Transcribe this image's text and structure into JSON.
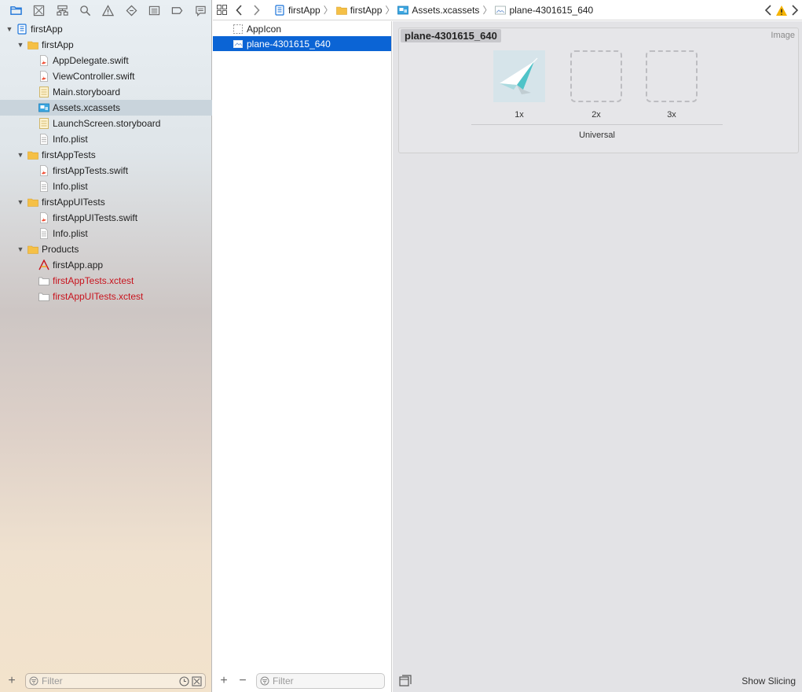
{
  "navigator": {
    "toolbar_icons": [
      "folder-icon",
      "source-control-icon",
      "symbol-icon",
      "find-icon",
      "issue-icon",
      "test-icon",
      "debug-icon",
      "breakpoint-icon",
      "report-icon"
    ],
    "tree": [
      {
        "label": "firstApp",
        "icon": "project-icon",
        "level": 0,
        "expanded": true
      },
      {
        "label": "firstApp",
        "icon": "folder-icon",
        "level": 1,
        "expanded": true
      },
      {
        "label": "AppDelegate.swift",
        "icon": "swift-file-icon",
        "level": 2
      },
      {
        "label": "ViewController.swift",
        "icon": "swift-file-icon",
        "level": 2
      },
      {
        "label": "Main.storyboard",
        "icon": "storyboard-icon",
        "level": 2
      },
      {
        "label": "Assets.xcassets",
        "icon": "asset-catalog-icon",
        "level": 2,
        "selected": true
      },
      {
        "label": "LaunchScreen.storyboard",
        "icon": "storyboard-icon",
        "level": 2
      },
      {
        "label": "Info.plist",
        "icon": "plist-icon",
        "level": 2
      },
      {
        "label": "firstAppTests",
        "icon": "folder-icon",
        "level": 1,
        "expanded": true
      },
      {
        "label": "firstAppTests.swift",
        "icon": "swift-file-icon",
        "level": 2
      },
      {
        "label": "Info.plist",
        "icon": "plist-icon",
        "level": 2
      },
      {
        "label": "firstAppUITests",
        "icon": "folder-icon",
        "level": 1,
        "expanded": true
      },
      {
        "label": "firstAppUITests.swift",
        "icon": "swift-file-icon",
        "level": 2
      },
      {
        "label": "Info.plist",
        "icon": "plist-icon",
        "level": 2
      },
      {
        "label": "Products",
        "icon": "folder-icon",
        "level": 1,
        "expanded": true
      },
      {
        "label": "firstApp.app",
        "icon": "app-icon",
        "level": 2
      },
      {
        "label": "firstAppTests.xctest",
        "icon": "xctest-icon",
        "level": 2,
        "missing": true
      },
      {
        "label": "firstAppUITests.xctest",
        "icon": "xctest-icon",
        "level": 2,
        "missing": true
      }
    ],
    "filter": {
      "placeholder": "Filter"
    }
  },
  "jumpbar": {
    "crumbs": [
      {
        "label": "firstApp",
        "icon": "project-icon"
      },
      {
        "label": "firstApp",
        "icon": "folder-icon"
      },
      {
        "label": "Assets.xcassets",
        "icon": "asset-catalog-icon"
      },
      {
        "label": "plane-4301615_640",
        "icon": "image-set-icon"
      }
    ]
  },
  "asset_list": {
    "items": [
      {
        "label": "AppIcon",
        "icon": "app-icon-set-icon"
      },
      {
        "label": "plane-4301615_640",
        "icon": "image-set-icon",
        "selected": true
      }
    ],
    "filter": {
      "placeholder": "Filter"
    }
  },
  "editor": {
    "set_name": "plane-4301615_640",
    "set_type": "Image",
    "slots": [
      {
        "label": "1x",
        "filled": true
      },
      {
        "label": "2x",
        "filled": false
      },
      {
        "label": "3x",
        "filled": false
      }
    ],
    "device": "Universal",
    "show_slicing": "Show Slicing"
  },
  "colors": {
    "selection_blue": "#0b64d5",
    "missing_red": "#c8141e",
    "folder_yellow": "#f5c046",
    "swift_orange": "#f05138"
  }
}
